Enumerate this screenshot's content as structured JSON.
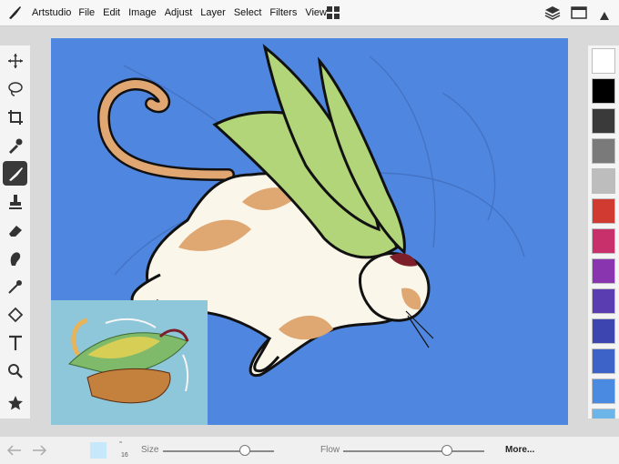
{
  "menu": {
    "app": "Artstudio",
    "items": [
      "File",
      "Edit",
      "Image",
      "Adjust",
      "Layer",
      "Select",
      "Filters",
      "View"
    ]
  },
  "header_icons": [
    "grid-icon",
    "layers-icon",
    "panel-icon",
    "triangle-up-icon"
  ],
  "tools": [
    "move",
    "lasso",
    "crop",
    "eyedropper",
    "brush",
    "stamp",
    "eraser",
    "smudge",
    "blur",
    "fill",
    "text",
    "zoom",
    "star"
  ],
  "active_tool": "brush",
  "palette": [
    "#ffffff",
    "#000000",
    "#3a3a3a",
    "#7a7a7a",
    "#bdbdbd",
    "#d03a30",
    "#c8306c",
    "#8a35b0",
    "#5a3db0",
    "#3d45b0",
    "#3e63c8",
    "#4a8ae0"
  ],
  "bottom": {
    "brush_size_value": "16",
    "size_label": "Size",
    "flow_label": "Flow",
    "more_label": "More...",
    "size_level": 0.74,
    "flow_level": 0.73
  },
  "colors": {
    "canvas": "#4f86df",
    "reference_bg": "#8ec6da",
    "wings": "#b2d57a",
    "body": "#fbf6ea",
    "fur": "#dfa772",
    "hair": "#7c1f2b",
    "outline": "#111111"
  }
}
